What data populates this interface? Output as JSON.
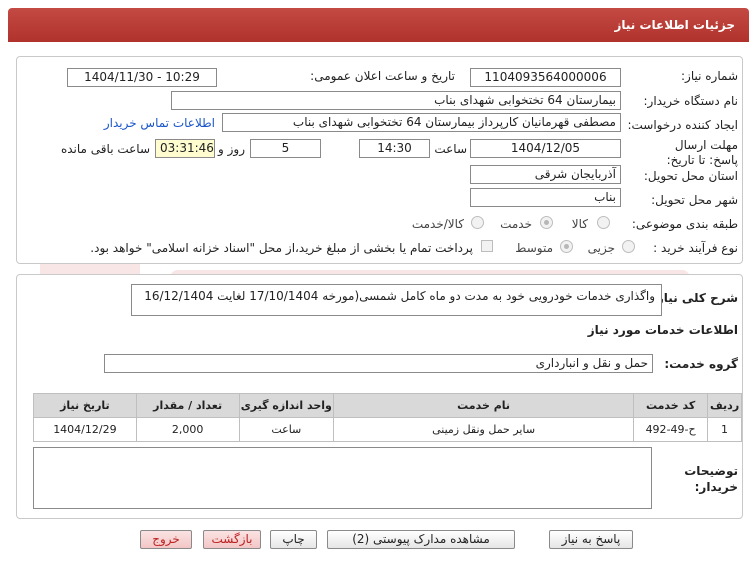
{
  "header": {
    "title": "جزئیات اطلاعات نیاز"
  },
  "form": {
    "need_number_label": "شماره نیاز:",
    "need_number": "1104093564000006",
    "announce_label": "تاریخ و ساعت اعلان عمومی:",
    "announce_value": "1404/11/30 - 10:29",
    "buyer_org_label": "نام دستگاه خریدار:",
    "buyer_org": "بیمارستان 64 تختخوابی شهدای بناب",
    "creator_label": "ایجاد کننده درخواست:",
    "creator": "مصطفی قهرمانیان کارپرداز بیمارستان 64 تختخوابی شهدای بناب",
    "contact_link": "اطلاعات تماس خریدار",
    "deadline_label": "مهلت ارسال پاسخ: تا تاریخ:",
    "deadline_date": "1404/12/05",
    "time_label": "ساعت",
    "deadline_time": "14:30",
    "days_value": "5",
    "days_label": "روز و",
    "remaining_time": "03:31:46",
    "remaining_label": "ساعت باقی مانده",
    "province_label": "استان محل تحویل:",
    "province": "آذربایجان شرقی",
    "city_label": "شهر محل تحویل:",
    "city": "بناب",
    "category_label": "طبقه بندی موضوعی:",
    "category_options": [
      "کالا",
      "خدمت",
      "کالا/خدمت"
    ],
    "category_selected": "خدمت",
    "process_label": "نوع فرآیند خرید :",
    "process_options": [
      "جزیی",
      "متوسط"
    ],
    "process_selected": "متوسط",
    "payment_note": "پرداخت تمام یا بخشی از مبلغ خرید،از محل \"اسناد خزانه اسلامی\" خواهد بود."
  },
  "description": {
    "label": "شرح کلی نیاز:",
    "text": "واگذاری خدمات خودرویی خود به مدت دو ماه کامل شمسی(مورخه 17/10/1404 لغایت 16/12/1404"
  },
  "services": {
    "section_title": "اطلاعات خدمات مورد نیاز",
    "group_label": "گروه خدمت:",
    "group_value": "حمل و نقل و انبارداری",
    "columns": [
      "ردیف",
      "کد خدمت",
      "نام خدمت",
      "واحد اندازه گیری",
      "تعداد / مقدار",
      "تاریخ نیاز"
    ],
    "rows": [
      [
        "1",
        "ح-49-492",
        "سایر حمل ونقل زمینی",
        "ساعت",
        "2,000",
        "1404/12/29"
      ]
    ]
  },
  "buyer_notes": {
    "label": "توضیحات خریدار:",
    "text": ""
  },
  "buttons": {
    "reply": "پاسخ به نیاز",
    "attachments": "مشاهده مدارک پیوستی (2)",
    "print": "چاپ",
    "back": "بازگشت",
    "exit": "خروج"
  },
  "colors": {
    "header": "#b1322c",
    "remaining_bg": "#fffcd0",
    "link": "#1a56c8"
  }
}
